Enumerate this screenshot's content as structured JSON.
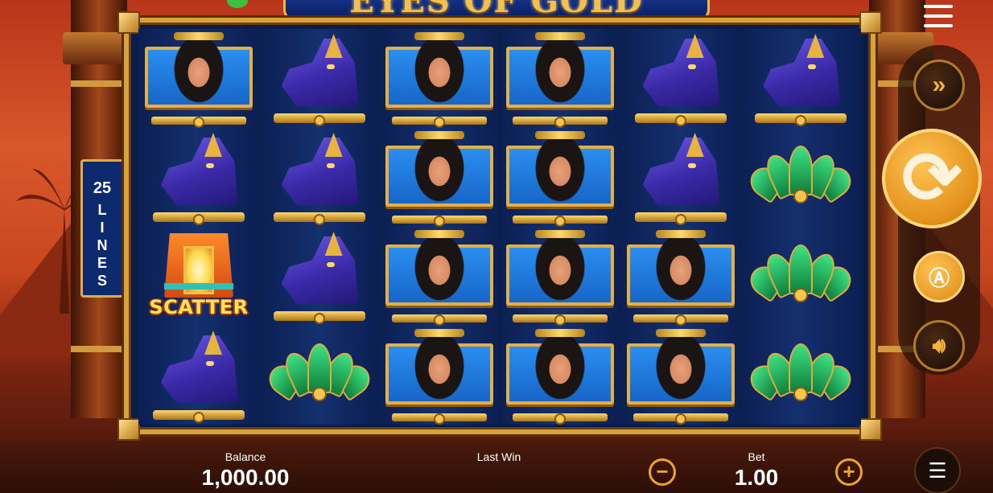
{
  "game": {
    "title": "EYES OF GOLD",
    "lines_count": "25",
    "lines_label": "LINES"
  },
  "reels": [
    [
      "queen",
      "jackal",
      "queen",
      "queen",
      "jackal",
      "jackal"
    ],
    [
      "jackal",
      "jackal",
      "queen",
      "queen",
      "jackal",
      "lotus"
    ],
    [
      "scatter",
      "jackal",
      "queen",
      "queen",
      "queen",
      "lotus"
    ],
    [
      "jackal",
      "lotus",
      "queen",
      "queen",
      "queen",
      "lotus"
    ]
  ],
  "symbols": {
    "scatter_label": "SCATTER"
  },
  "controls": {
    "turbo_icon": "fast-forward-icon",
    "spin_icon": "refresh-icon",
    "auto_icon": "autoplay-icon",
    "sound_icon": "speaker-icon",
    "menu_icon": "hamburger-menu-icon",
    "coins_icon": "coin-stack-icon"
  },
  "bottom": {
    "balance_label": "Balance",
    "balance_value": "1,000.00",
    "last_win_label": "Last Win",
    "last_win_value": "",
    "bet_label": "Bet",
    "bet_value": "1.00",
    "minus_label": "−",
    "plus_label": "+"
  },
  "colors": {
    "accent_gold": "#e1ad42",
    "spin_orange": "#e3901a",
    "reel_blue": "#0b1f52"
  }
}
